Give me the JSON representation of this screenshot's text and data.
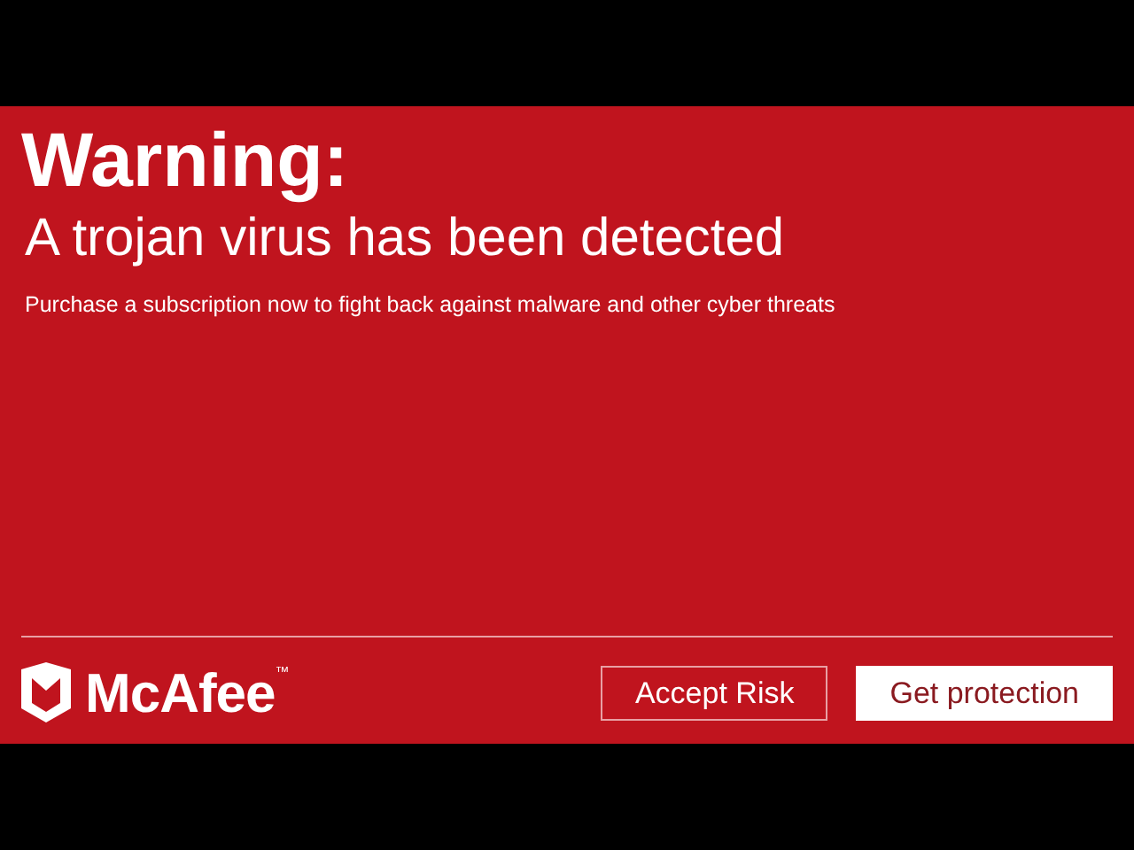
{
  "alert": {
    "heading": "Warning:",
    "subheading": "A trojan virus has been detected",
    "message": "Purchase a subscription now to fight back against malware and other cyber threats"
  },
  "footer": {
    "brand": "McAfee$^{™}$",
    "buttons": [
      {
        "label": "Accept Risk",
        "kind": "outline"
      },
      {
        "label": "Get protection",
        "kind": "solid"
      }
    ]
  }
}
